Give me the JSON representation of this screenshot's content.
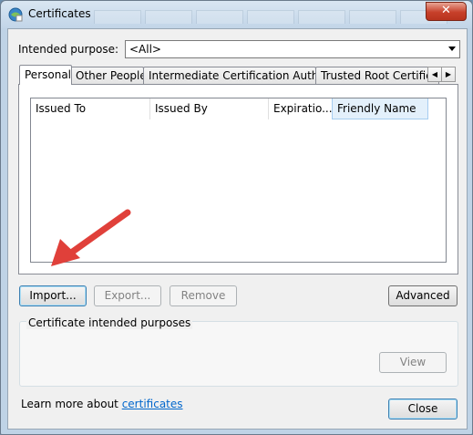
{
  "window": {
    "title": "Certificates"
  },
  "purpose": {
    "label": "Intended purpose:",
    "value": "<All>"
  },
  "tabs": [
    {
      "label": "Personal"
    },
    {
      "label": "Other People"
    },
    {
      "label": "Intermediate Certification Authorities"
    },
    {
      "label": "Trusted Root Certification"
    }
  ],
  "columns": [
    {
      "label": "Issued To"
    },
    {
      "label": "Issued By"
    },
    {
      "label": "Expiratio..."
    },
    {
      "label": "Friendly Name"
    }
  ],
  "buttons": {
    "import": "Import...",
    "export": "Export...",
    "remove": "Remove",
    "advanced": "Advanced",
    "view": "View",
    "close": "Close"
  },
  "group": {
    "title": "Certificate intended purposes"
  },
  "footer": {
    "text": "Learn more about ",
    "link": "certificates"
  },
  "colors": {
    "annotation_arrow": "#e0403a",
    "link": "#0066cc"
  }
}
